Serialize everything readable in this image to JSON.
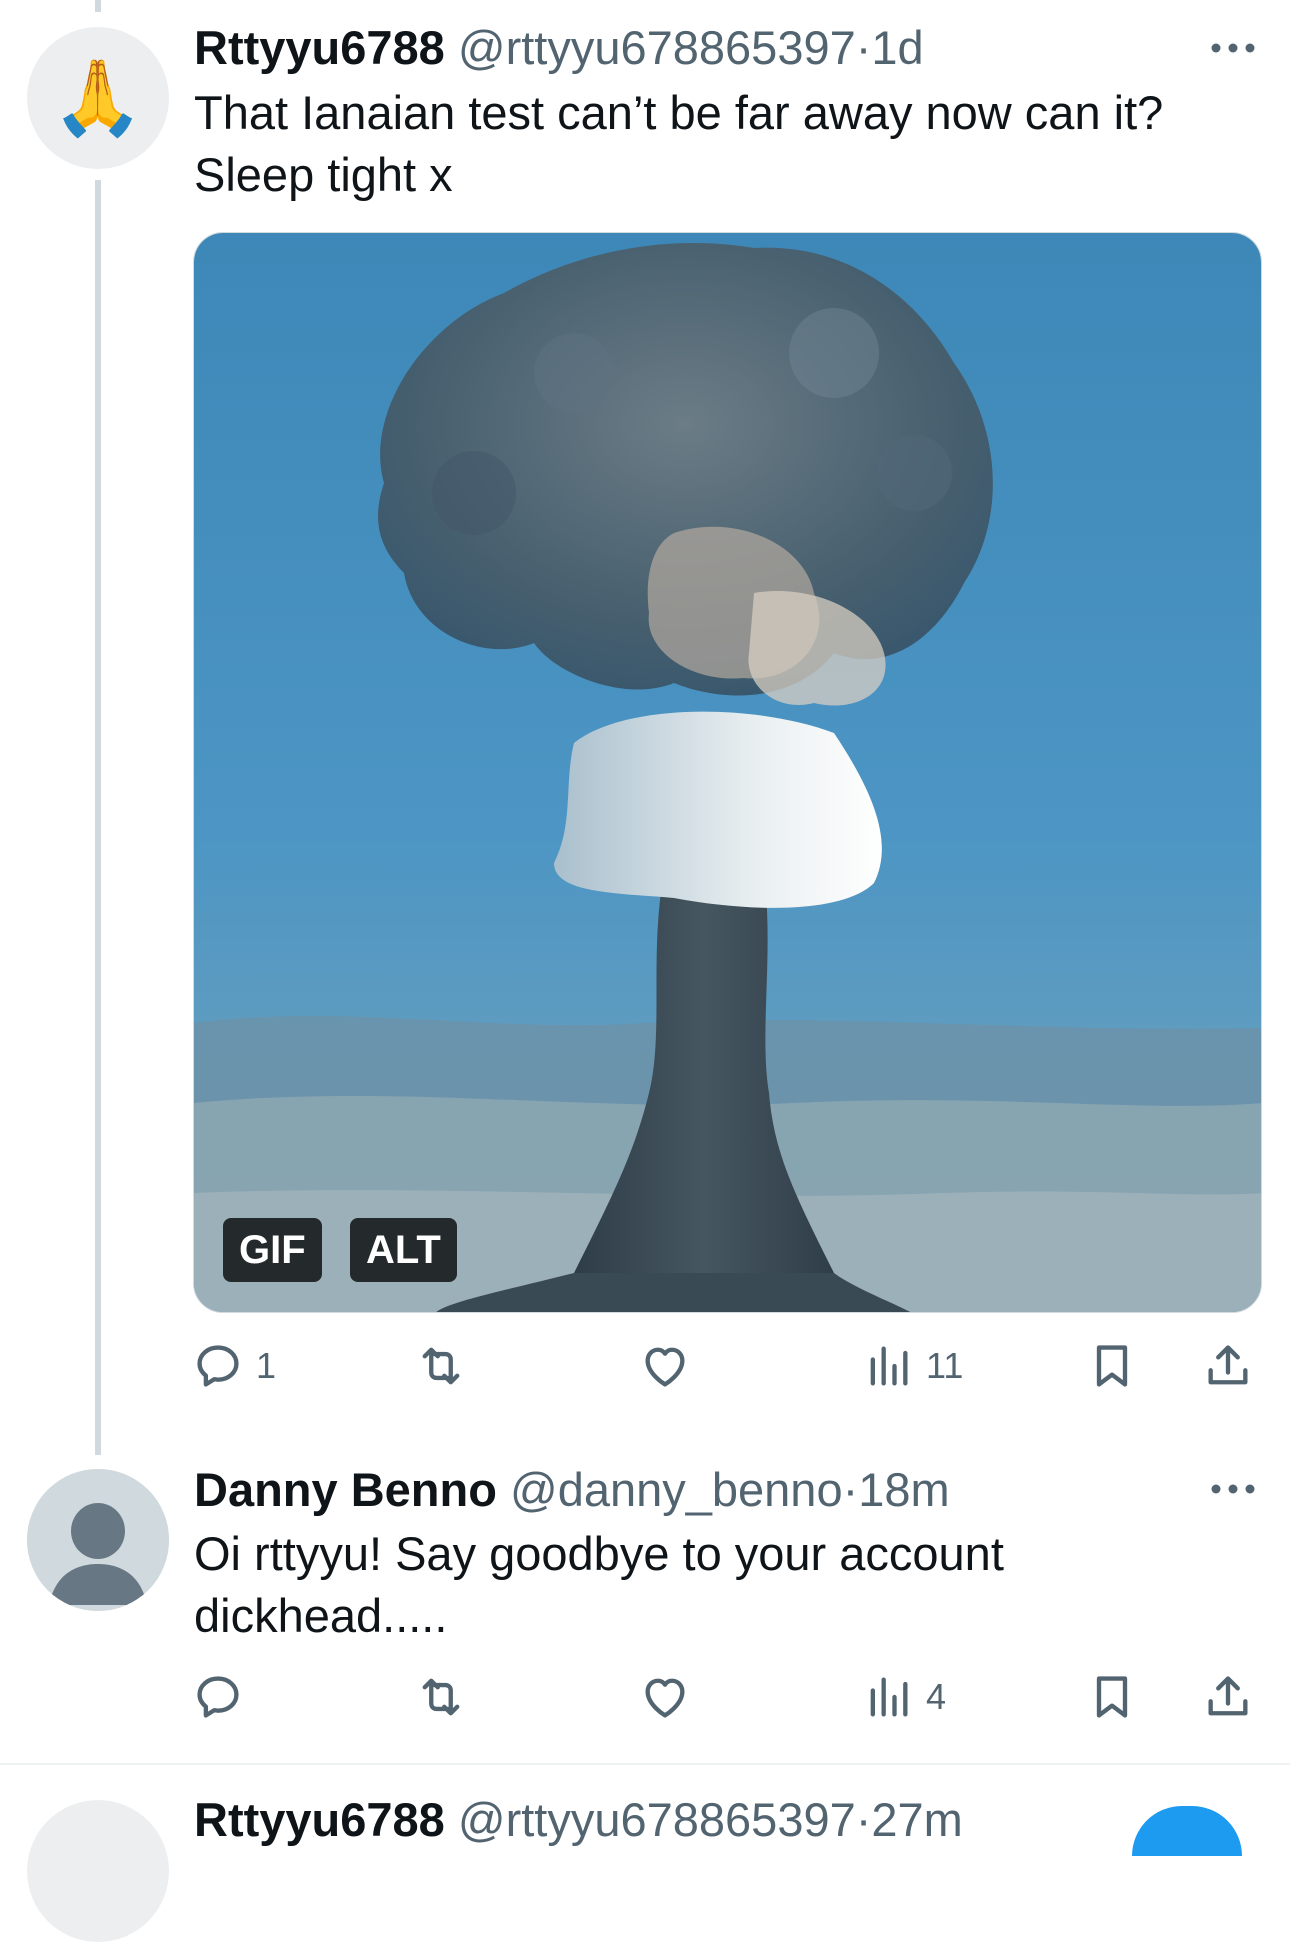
{
  "tweet1": {
    "avatar_emoji": "🙏",
    "name": "Rttyyu6788",
    "handle": "@rttyyu678865397",
    "time": "1d",
    "text_lines": [
      "That Ianaian test can’t be far away now can it?",
      "Sleep tight x"
    ],
    "media": {
      "badge_gif": "GIF",
      "badge_alt": "ALT"
    },
    "actions": {
      "reply_count": "1",
      "views_count": "11"
    }
  },
  "tweet2": {
    "name": "Danny Benno",
    "handle": "@danny_benno",
    "time": "18m",
    "text_lines": [
      "Oi rttyyu!  Say goodbye to your account",
      "dickhead....."
    ],
    "actions": {
      "views_count": "4"
    }
  },
  "tweet3": {
    "name": "Rttyyu6788",
    "handle": "@rttyyu678865397",
    "time": "27m"
  },
  "separator": "·",
  "colors": {
    "secondary_text": "#536471",
    "primary_text": "#0f1419",
    "thread_line": "#cfd9de",
    "accent": "#1d9bf0"
  }
}
